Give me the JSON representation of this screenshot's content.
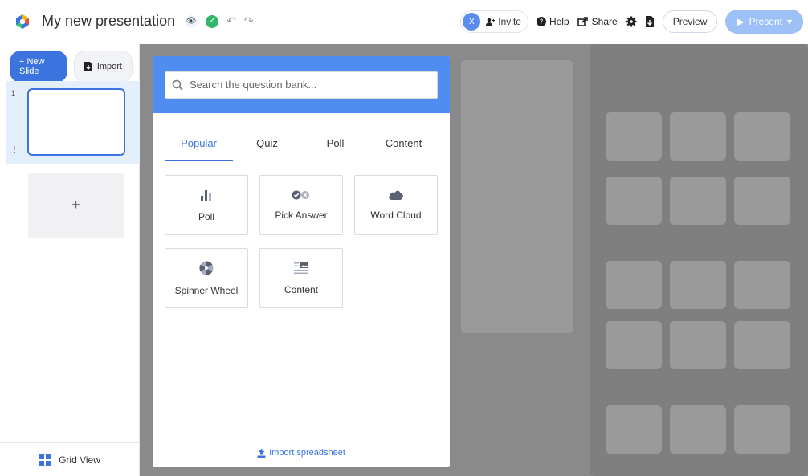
{
  "app": {
    "title": "My new presentation"
  },
  "topbar": {
    "avatar_initial": "X",
    "invite_label": "Invite",
    "help_label": "Help",
    "share_label": "Share",
    "preview_label": "Preview",
    "present_label": "Present"
  },
  "sidebar": {
    "new_slide_label": "+ New Slide",
    "import_label": "Import",
    "slides": [
      {
        "number": "1"
      }
    ],
    "add_slide_symbol": "+",
    "grid_view_label": "Grid View"
  },
  "modal": {
    "search_placeholder": "Search the question bank...",
    "tabs": [
      {
        "label": "Popular",
        "active": true
      },
      {
        "label": "Quiz",
        "active": false
      },
      {
        "label": "Poll",
        "active": false
      },
      {
        "label": "Content",
        "active": false
      }
    ],
    "cards": [
      {
        "label": "Poll",
        "icon": "bar-chart-icon"
      },
      {
        "label": "Pick Answer",
        "icon": "pick-answer-icon"
      },
      {
        "label": "Word Cloud",
        "icon": "cloud-icon"
      },
      {
        "label": "Spinner Wheel",
        "icon": "spinner-wheel-icon"
      },
      {
        "label": "Content",
        "icon": "content-icon"
      }
    ],
    "import_spreadsheet_label": "Import spreadsheet"
  },
  "colors": {
    "primary": "#3b74de",
    "header_blue": "#4f8ef0",
    "success": "#30b76a",
    "icon_gray": "#5a6272"
  }
}
